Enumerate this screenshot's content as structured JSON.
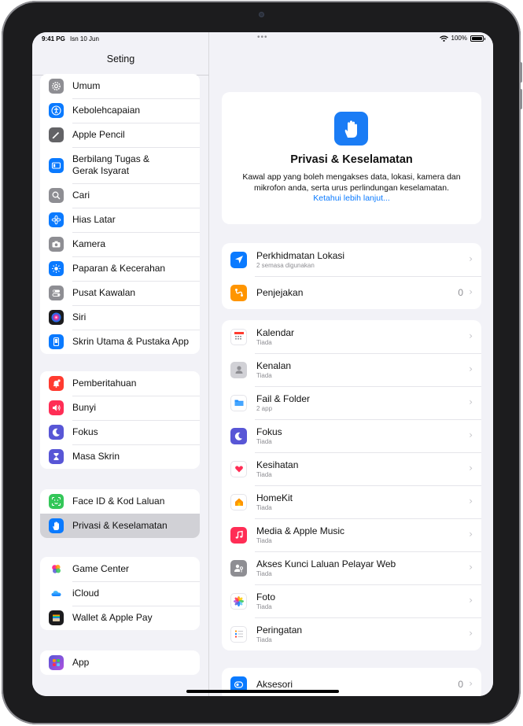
{
  "status_bar": {
    "time": "9:41 PG",
    "date": "Isn 10 Jun",
    "battery": "100%",
    "battery_level": 1.0
  },
  "sidebar": {
    "title": "Seting",
    "groups": [
      {
        "items": [
          {
            "label": "Umum",
            "icon": "gear-icon",
            "color": "#8e8e93"
          },
          {
            "label": "Kebolehcapaian",
            "icon": "accessibility-icon",
            "color": "#0a7aff"
          },
          {
            "label": "Apple Pencil",
            "icon": "pencil-icon",
            "color": "#636366"
          },
          {
            "label": "Berbilang Tugas &\nGerak Isyarat",
            "icon": "multitasking-icon",
            "color": "#0a7aff"
          },
          {
            "label": "Cari",
            "icon": "search-icon",
            "color": "#8e8e93"
          },
          {
            "label": "Hias Latar",
            "icon": "flower-icon",
            "color": "#0a7aff"
          },
          {
            "label": "Kamera",
            "icon": "camera-icon",
            "color": "#8e8e93"
          },
          {
            "label": "Paparan & Kecerahan",
            "icon": "sun-icon",
            "color": "#0a7aff"
          },
          {
            "label": "Pusat Kawalan",
            "icon": "toggles-icon",
            "color": "#8e8e93"
          },
          {
            "label": "Siri",
            "icon": "siri-icon",
            "color": "#1c1c1e"
          },
          {
            "label": "Skrin Utama & Pustaka App",
            "icon": "home-screen-icon",
            "color": "#0a7aff"
          }
        ]
      },
      {
        "items": [
          {
            "label": "Pemberitahuan",
            "icon": "bell-icon",
            "color": "#ff3b30"
          },
          {
            "label": "Bunyi",
            "icon": "speaker-icon",
            "color": "#ff2d55"
          },
          {
            "label": "Fokus",
            "icon": "moon-icon",
            "color": "#5856d6"
          },
          {
            "label": "Masa Skrin",
            "icon": "hourglass-icon",
            "color": "#5856d6"
          }
        ]
      },
      {
        "items": [
          {
            "label": "Face ID & Kod Laluan",
            "icon": "faceid-icon",
            "color": "#34c759"
          },
          {
            "label": "Privasi & Keselamatan",
            "icon": "hand-icon",
            "color": "#0a7aff",
            "selected": true
          }
        ]
      },
      {
        "items": [
          {
            "label": "Game Center",
            "icon": "game-center-icon",
            "color": "#ffffff"
          },
          {
            "label": "iCloud",
            "icon": "cloud-icon",
            "color": "#ffffff"
          },
          {
            "label": "Wallet & Apple Pay",
            "icon": "wallet-icon",
            "color": "#1c1c1e"
          }
        ]
      },
      {
        "items": [
          {
            "label": "App",
            "icon": "apps-grid-icon",
            "color": "#5856d6"
          }
        ]
      }
    ]
  },
  "main": {
    "hero": {
      "title": "Privasi & Keselamatan",
      "description": "Kawal app yang boleh mengakses data, lokasi, kamera dan mikrofon anda, serta urus perlindungan keselamatan.",
      "link": "Ketahui lebih lanjut..."
    },
    "groups": [
      {
        "items": [
          {
            "title": "Perkhidmatan Lokasi",
            "subtitle": "2 semasa digunakan",
            "value": "",
            "icon": "location-arrow-icon",
            "color": "#0a7aff"
          },
          {
            "title": "Penjejakan",
            "subtitle": "",
            "value": "0",
            "icon": "tracking-icon",
            "color": "#ff9500"
          }
        ]
      },
      {
        "items": [
          {
            "title": "Kalendar",
            "subtitle": "Tiada",
            "value": "",
            "icon": "calendar-icon",
            "color": "#ffffff"
          },
          {
            "title": "Kenalan",
            "subtitle": "Tiada",
            "value": "",
            "icon": "contacts-icon",
            "color": "#d1d1d6"
          },
          {
            "title": "Fail & Folder",
            "subtitle": "2 app",
            "value": "",
            "icon": "folder-icon",
            "color": "#ffffff"
          },
          {
            "title": "Fokus",
            "subtitle": "Tiada",
            "value": "",
            "icon": "moon-icon",
            "color": "#5856d6"
          },
          {
            "title": "Kesihatan",
            "subtitle": "Tiada",
            "value": "",
            "icon": "heart-icon",
            "color": "#ffffff"
          },
          {
            "title": "HomeKit",
            "subtitle": "Tiada",
            "value": "",
            "icon": "home-icon",
            "color": "#ffffff"
          },
          {
            "title": "Media & Apple Music",
            "subtitle": "Tiada",
            "value": "",
            "icon": "music-note-icon",
            "color": "#ff2d55"
          },
          {
            "title": "Akses Kunci Laluan Pelayar Web",
            "subtitle": "Tiada",
            "value": "",
            "icon": "passkey-icon",
            "color": "#8e8e93"
          },
          {
            "title": "Foto",
            "subtitle": "Tiada",
            "value": "",
            "icon": "photos-icon",
            "color": "#ffffff"
          },
          {
            "title": "Peringatan",
            "subtitle": "Tiada",
            "value": "",
            "icon": "reminders-icon",
            "color": "#ffffff"
          }
        ]
      },
      {
        "items": [
          {
            "title": "Aksesori",
            "subtitle": "",
            "value": "0",
            "icon": "accessory-icon",
            "color": "#0a7aff"
          }
        ]
      }
    ]
  }
}
